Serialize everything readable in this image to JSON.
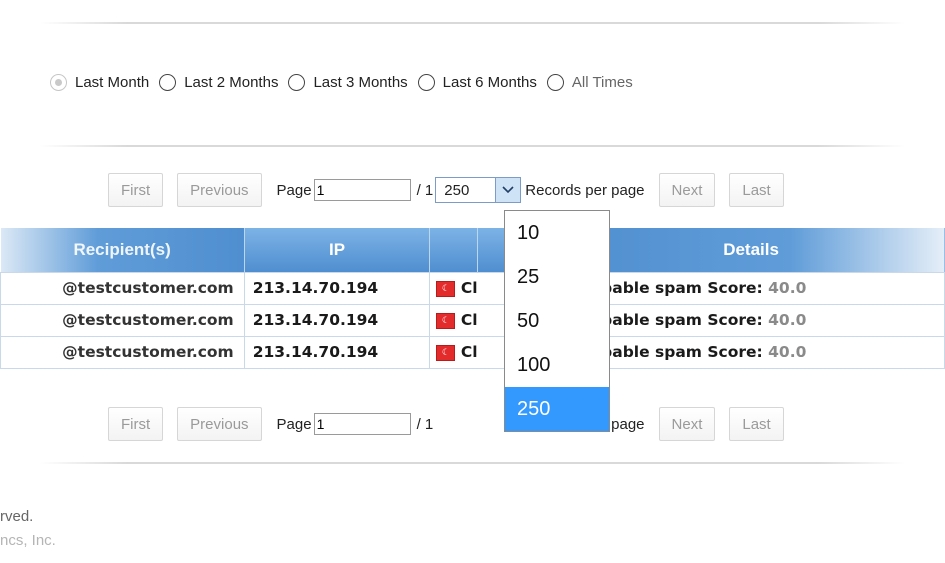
{
  "date_range": {
    "options": [
      {
        "label": "Last Month",
        "selected": true
      },
      {
        "label": "Last 2 Months",
        "selected": false
      },
      {
        "label": "Last 3 Months",
        "selected": false
      },
      {
        "label": "Last 6 Months",
        "selected": false
      },
      {
        "label": "All Times",
        "selected": false
      }
    ]
  },
  "pager_top": {
    "first_label": "First",
    "previous_label": "Previous",
    "page_label": "Page",
    "page_value": "1",
    "of_label": "/ 1",
    "records_per_page_value": "250",
    "records_per_page_label": "Records per page",
    "next_label": "Next",
    "last_label": "Last"
  },
  "pager_bottom": {
    "first_label": "First",
    "previous_label": "Previous",
    "page_label": "Page",
    "page_value": "1",
    "of_label": "/ 1",
    "records_per_page_label": "Records per page",
    "next_label": "Next",
    "last_label": "Last"
  },
  "records_dropdown": {
    "options": [
      "10",
      "25",
      "50",
      "100",
      "250"
    ],
    "selected": "250"
  },
  "table": {
    "headers": {
      "recipient": "Recipient(s)",
      "ip": "IP",
      "flag": "",
      "blank": "",
      "details": "Details"
    },
    "rows": [
      {
        "recipient": "@testcustomer.com",
        "ip": "213.14.70.194",
        "flag_icon": "turkey-flag-icon",
        "col3": "Cl",
        "details_text": "s probable spam Score:",
        "score": "40.0"
      },
      {
        "recipient": "@testcustomer.com",
        "ip": "213.14.70.194",
        "flag_icon": "turkey-flag-icon",
        "col3": "Cl",
        "details_text": "s probable spam Score:",
        "score": "40.0"
      },
      {
        "recipient": "@testcustomer.com",
        "ip": "213.14.70.194",
        "flag_icon": "turkey-flag-icon",
        "col3": "Cl",
        "details_text": "s probable spam Score:",
        "score": "40.0"
      }
    ]
  },
  "footer": {
    "line1": "rved.",
    "line2": "ncs, Inc."
  }
}
